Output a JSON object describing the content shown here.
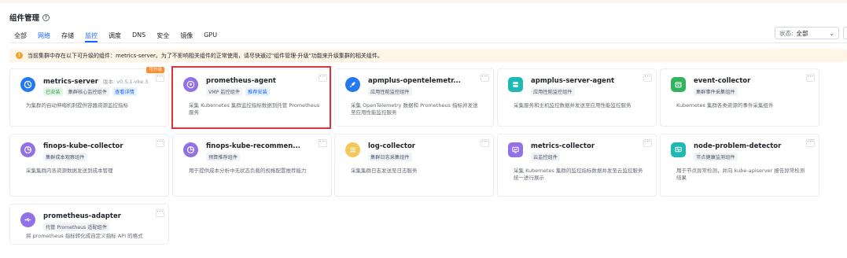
{
  "page": {
    "title": "组件管理",
    "tabs": [
      {
        "label": "全部"
      },
      {
        "label": "网络"
      },
      {
        "label": "存储"
      },
      {
        "label": "监控"
      },
      {
        "label": "调度"
      },
      {
        "label": "DNS"
      },
      {
        "label": "安全"
      },
      {
        "label": "镜像"
      },
      {
        "label": "GPU"
      }
    ],
    "active_tab": "监控",
    "filter": {
      "label": "状态:",
      "value": "全部"
    }
  },
  "banner": {
    "text": "当前集群中存在以下可升级的组件：metrics-server。为了不影响相关组件的正常使用，请尽快通过\"组件管理-升级\"功能来升级集群的相关组件。"
  },
  "cards": [
    {
      "name": "metrics-server",
      "version": "版本: v0.5.1-vke.3",
      "badge": "可升级",
      "tags": [
        {
          "text": "已安装",
          "style": "green"
        },
        {
          "text": "集群核心监控组件",
          "style": "gray"
        },
        {
          "text": "查看详情",
          "style": "blue"
        }
      ],
      "desc": "为集群的自动伸缩机制提供容器资源监控指标",
      "icon": "clock-icon",
      "color": "#2478f2",
      "highlighted": false
    },
    {
      "name": "prometheus-agent",
      "tags": [
        {
          "text": "VMP 监控组件",
          "style": "gray"
        },
        {
          "text": "推荐安装",
          "style": "blue"
        }
      ],
      "desc": "采集 Kubernetes 集群监控指标数据到托管 Prometheus 服务",
      "icon": "flame-icon",
      "color": "#9270e6",
      "highlighted": true
    },
    {
      "name": "apmplus-opentelemetr...",
      "tags": [
        {
          "text": "应用性能监控组件",
          "style": "gray"
        }
      ],
      "desc": "采集 OpenTelemetry 数据和 Prometheus 指标并发送至应用性能监控服务",
      "icon": "rocket-icon",
      "color": "#2478f2",
      "highlighted": false
    },
    {
      "name": "apmplus-server-agent",
      "tags": [
        {
          "text": "应用性能监控组件",
          "style": "gray"
        }
      ],
      "desc": "采集服务和主机监控数据并发送至应用性能监控服务",
      "icon": "server-icon",
      "color": "#1fb9b3",
      "highlighted": false
    },
    {
      "name": "event-collector",
      "tags": [
        {
          "text": "集群事件采集组件",
          "style": "gray"
        }
      ],
      "desc": "Kubernetes 集群各类资源的事件采集组件",
      "icon": "calendar-icon",
      "color": "#34b35e",
      "highlighted": false
    },
    {
      "name": "finops-kube-collector",
      "tags": [
        {
          "text": "集群成本观察组件",
          "style": "gray"
        }
      ],
      "desc": "采集集群内各资源数据发送到成本管理",
      "icon": "pie-chart-icon",
      "color": "#9270e6",
      "highlighted": false
    },
    {
      "name": "finops-kube-recommen...",
      "tags": [
        {
          "text": "预算推荐组件",
          "style": "gray"
        }
      ],
      "desc": "用于提供成本分析中无状态负载的规格配置推荐能力",
      "icon": "pie-chart-icon",
      "color": "#9270e6",
      "highlighted": false
    },
    {
      "name": "log-collector",
      "tags": [
        {
          "text": "集群日志采集组件",
          "style": "gray"
        }
      ],
      "desc": "采集集群日志发送至日志服务",
      "icon": "log-list-icon",
      "color": "#f3c85b",
      "highlighted": false
    },
    {
      "name": "metrics-collector",
      "tags": [
        {
          "text": "云监控组件",
          "style": "gray"
        }
      ],
      "desc": "采集 Kubernetes 集群的监控指标数据并发至云监控服务统一进行展示",
      "icon": "monitor-chart-icon",
      "color": "#9270e6",
      "highlighted": false
    },
    {
      "name": "node-problem-detector",
      "tags": [
        {
          "text": "节点健康监测组件",
          "style": "gray"
        }
      ],
      "desc": "用于节点异常检测，并向 kube-apiserver 报告异常检测结果",
      "icon": "pulse-monitor-icon",
      "color": "#1fb9b3",
      "highlighted": false
    },
    {
      "name": "prometheus-adapter",
      "tags": [
        {
          "text": "托管 Prometheus 适配组件",
          "style": "gray"
        }
      ],
      "desc": "将 prometheus 指标转化成自定义指标 API 的格式",
      "icon": "usb-icon",
      "color": "#9270e6",
      "highlighted": false
    }
  ]
}
